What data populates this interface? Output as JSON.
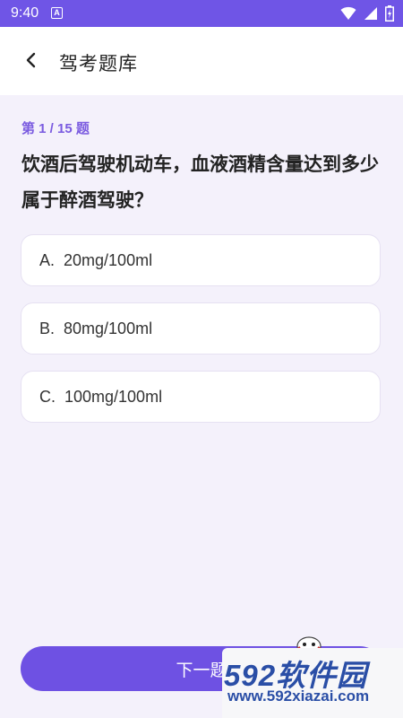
{
  "status_bar": {
    "time": "9:40",
    "app_icon_letter": "A"
  },
  "header": {
    "title": "驾考题库"
  },
  "quiz": {
    "progress": "第 1 / 15 题",
    "question": "饮酒后驾驶机动车，血液酒精含量达到多少属于醉酒驾驶？",
    "options": [
      {
        "letter": "A.",
        "text": "20mg/100ml"
      },
      {
        "letter": "B.",
        "text": "80mg/100ml"
      },
      {
        "letter": "C.",
        "text": "100mg/100ml"
      }
    ]
  },
  "footer": {
    "next_label": "下一题"
  },
  "watermark": {
    "logo": "592软件园",
    "url": "www.592xiazai.com"
  },
  "colors": {
    "primary": "#6e51e3",
    "accent_text": "#7a5be0",
    "background": "#f4f1fb"
  }
}
